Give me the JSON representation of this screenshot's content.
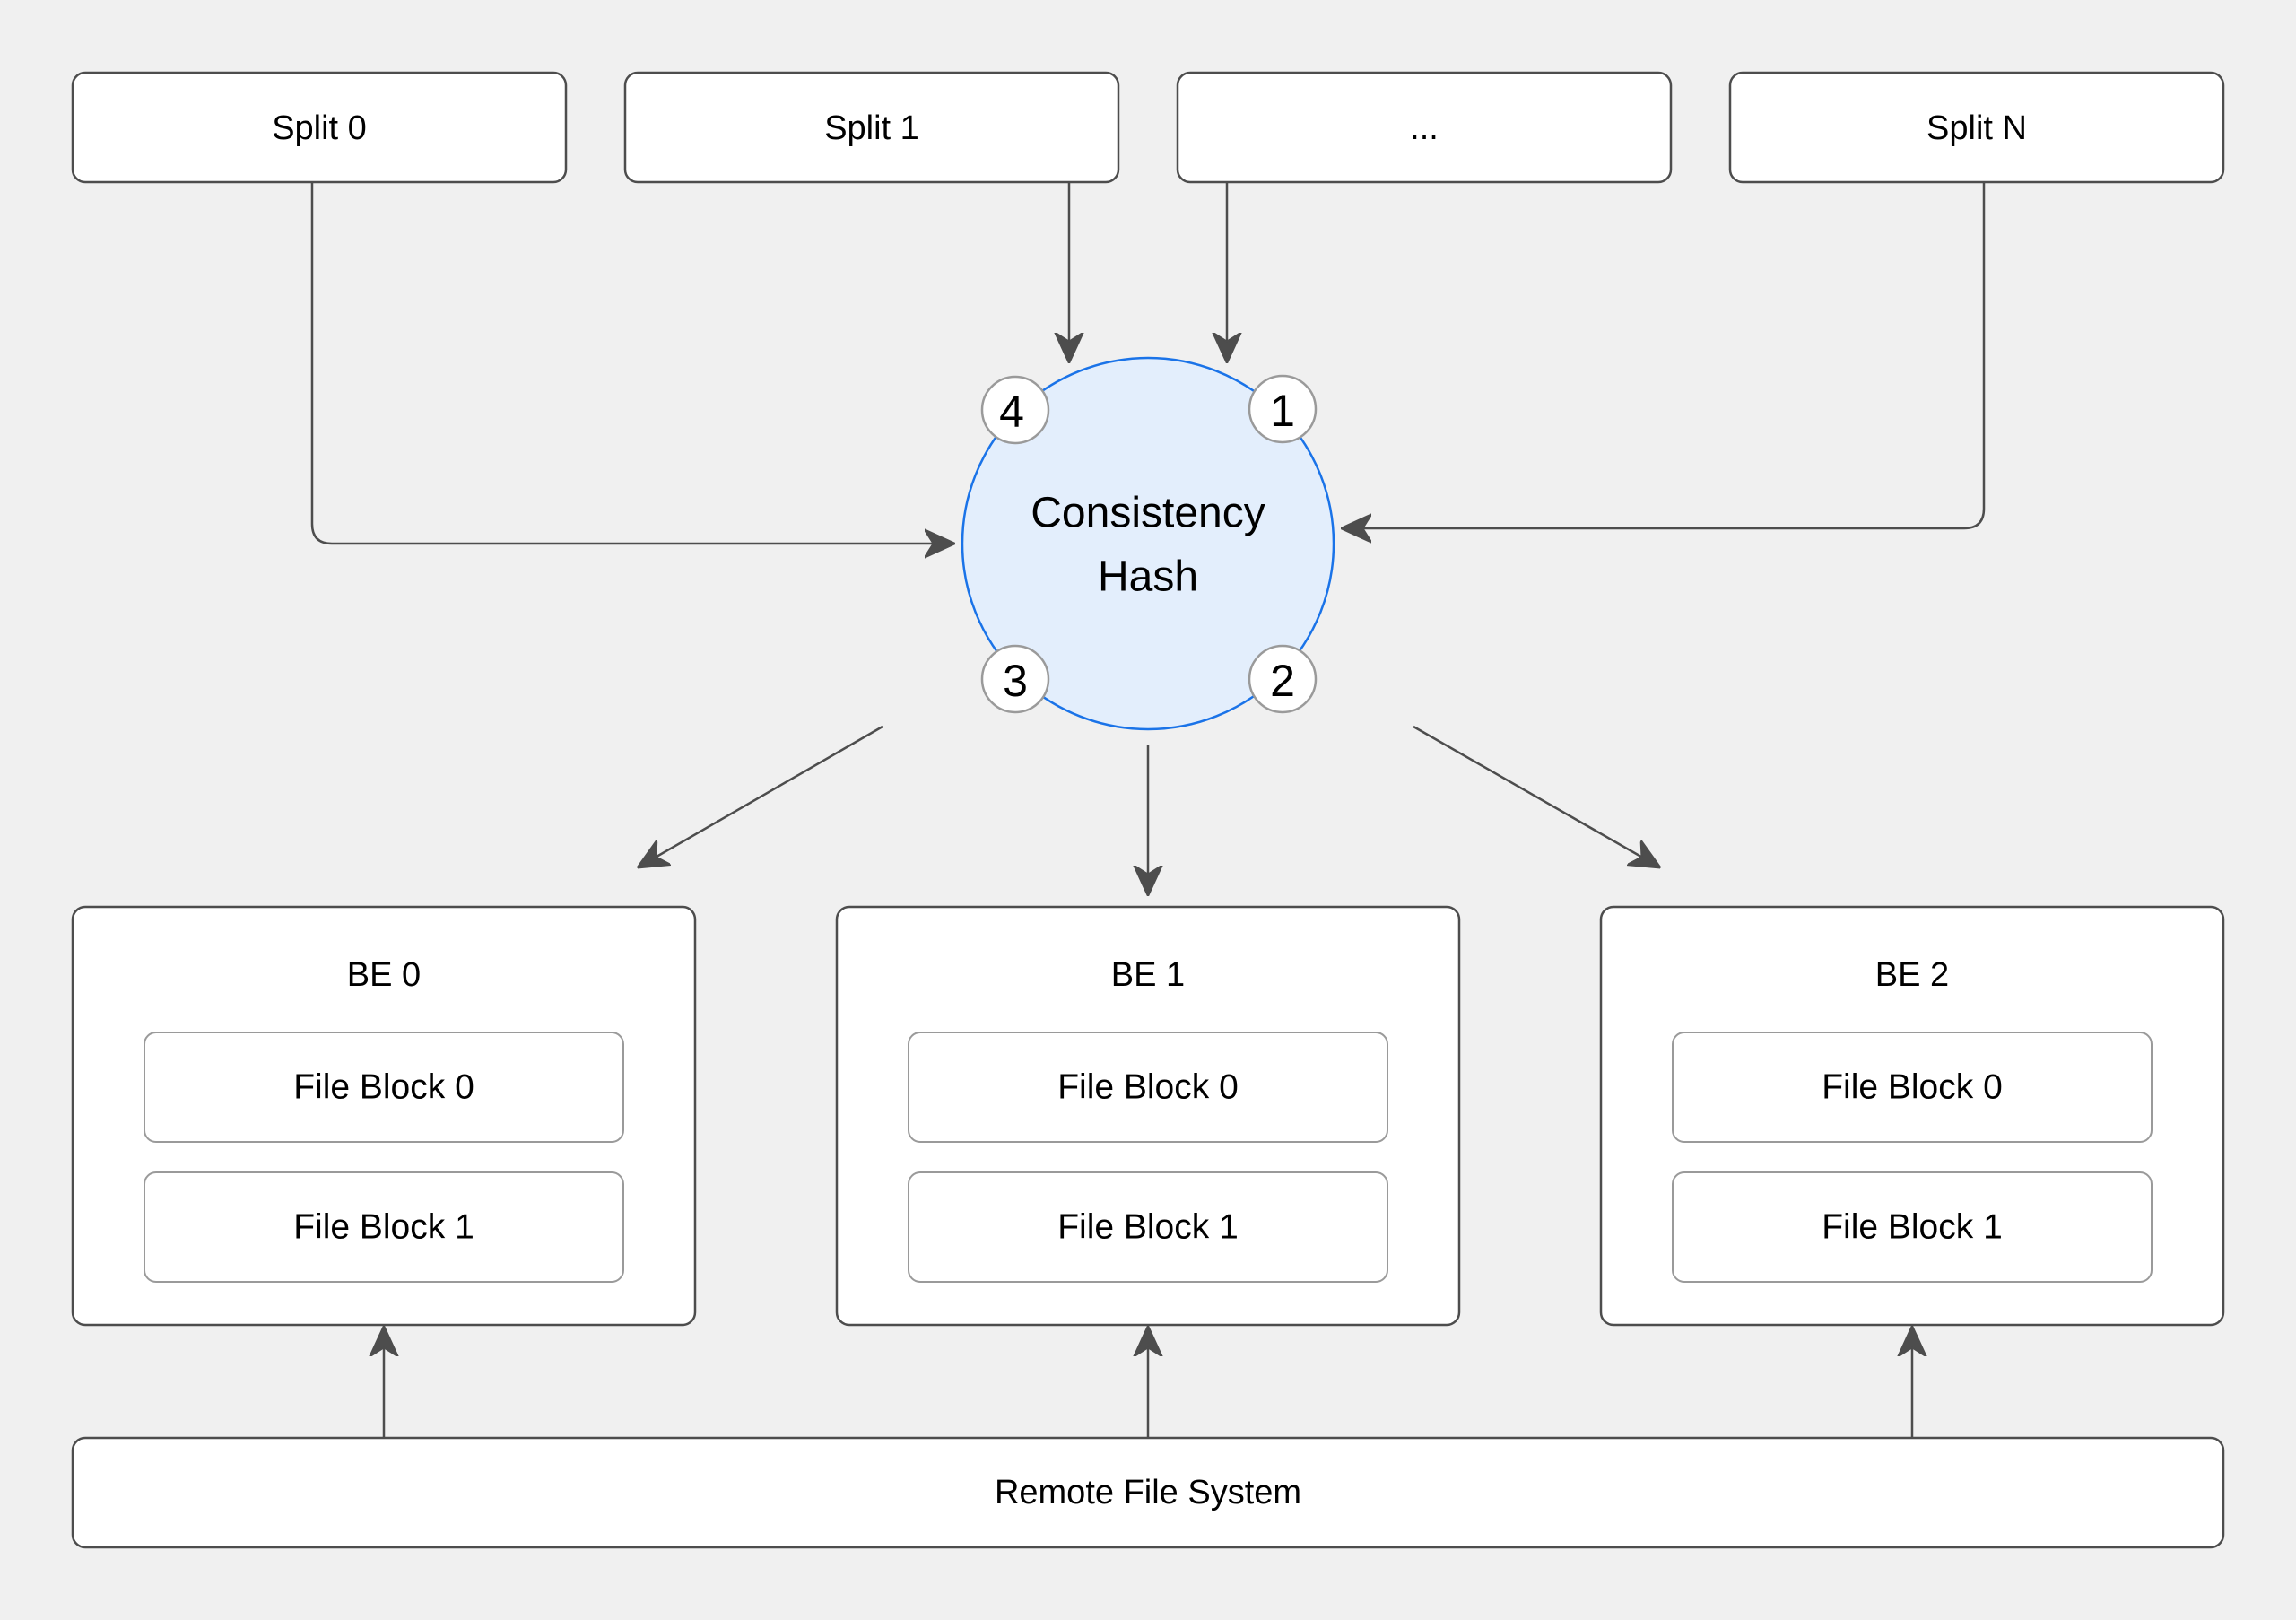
{
  "colors": {
    "background": "#f0f0f0",
    "box_stroke": "#4d4d4d",
    "inner_stroke": "#9a9a9a",
    "hash_fill": "#e3eefc",
    "hash_stroke": "#1a73e8",
    "arrow": "#4d4d4d"
  },
  "splits": [
    {
      "id": "split-0",
      "label": "Split 0"
    },
    {
      "id": "split-1",
      "label": "Split 1"
    },
    {
      "id": "split-ellipsis",
      "label": "..."
    },
    {
      "id": "split-n",
      "label": "Split N"
    }
  ],
  "hash": {
    "title_line1": "Consistency",
    "title_line2": "Hash",
    "nodes": [
      {
        "label": "1",
        "position": "top-right"
      },
      {
        "label": "2",
        "position": "bottom-right"
      },
      {
        "label": "3",
        "position": "bottom-left"
      },
      {
        "label": "4",
        "position": "top-left"
      }
    ]
  },
  "backends": [
    {
      "label": "BE 0",
      "blocks": [
        "File Block 0",
        "File Block 1"
      ]
    },
    {
      "label": "BE 1",
      "blocks": [
        "File Block 0",
        "File Block 1"
      ]
    },
    {
      "label": "BE 2",
      "blocks": [
        "File Block 0",
        "File Block 1"
      ]
    }
  ],
  "remote": {
    "label": "Remote File System"
  },
  "edges": [
    {
      "from": "Split 0",
      "to": "Consistency Hash"
    },
    {
      "from": "Split 1",
      "to": "Consistency Hash"
    },
    {
      "from": "...",
      "to": "Consistency Hash"
    },
    {
      "from": "Split N",
      "to": "Consistency Hash"
    },
    {
      "from": "Consistency Hash",
      "to": "BE 0"
    },
    {
      "from": "Consistency Hash",
      "to": "BE 1"
    },
    {
      "from": "Consistency Hash",
      "to": "BE 2"
    },
    {
      "from": "Remote File System",
      "to": "BE 0"
    },
    {
      "from": "Remote File System",
      "to": "BE 1"
    },
    {
      "from": "Remote File System",
      "to": "BE 2"
    }
  ]
}
